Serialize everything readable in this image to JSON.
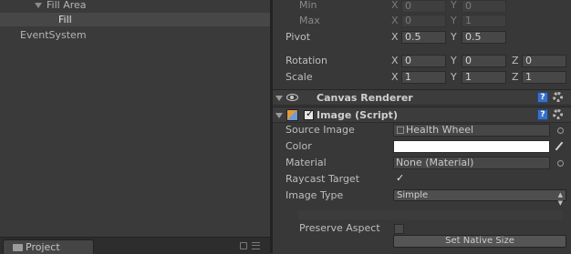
{
  "hierarchy": {
    "items": [
      {
        "label": "Fill Area"
      },
      {
        "label": "Fill"
      },
      {
        "label": "EventSystem"
      }
    ],
    "project_tab": "Project"
  },
  "inspector": {
    "min": {
      "label": "Min",
      "x": "0",
      "y": "0"
    },
    "max": {
      "label": "Max",
      "x": "0",
      "y": "1"
    },
    "pivot": {
      "label": "Pivot",
      "x": "0.5",
      "y": "0.5"
    },
    "rotation": {
      "label": "Rotation",
      "x": "0",
      "y": "0",
      "z": "0"
    },
    "scale": {
      "label": "Scale",
      "x": "1",
      "y": "1",
      "z": "1"
    },
    "axes": {
      "x": "X",
      "y": "Y",
      "z": "Z"
    },
    "canvas_renderer": {
      "title": "Canvas Renderer"
    },
    "image_script": {
      "title": "Image (Script)",
      "enabled": true,
      "source_image": {
        "label": "Source Image",
        "value": "Health Wheel"
      },
      "color": {
        "label": "Color",
        "value": "#ffffff"
      },
      "material": {
        "label": "Material",
        "value": "None (Material)"
      },
      "raycast_target": {
        "label": "Raycast Target",
        "checked": true
      },
      "image_type": {
        "label": "Image Type",
        "value": "Simple"
      },
      "preserve_aspect": {
        "label": "Preserve Aspect",
        "checked": false
      },
      "set_native_size": "Set Native Size"
    },
    "help_glyph": "?"
  },
  "icons": {
    "eye": "eye-icon",
    "help": "help-icon",
    "gear": "gear-icon",
    "image": "image-component-icon",
    "lock": "lock-icon",
    "menu": "menu-icon",
    "folder": "folder-icon"
  },
  "colors": {
    "panel_bg": "#383838",
    "selection": "#474747",
    "help_blue": "#3b70c6"
  }
}
